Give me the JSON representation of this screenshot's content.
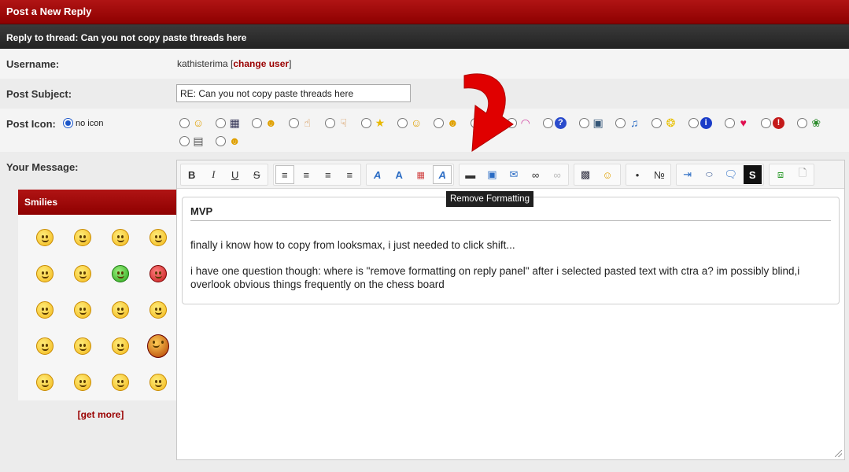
{
  "header": {
    "title": "Post a New Reply"
  },
  "thread": {
    "label": "Reply to thread: Can you not copy paste threads here"
  },
  "username": {
    "label": "Username:",
    "value": "kathisterima",
    "change_label": "change user",
    "open_bracket": "[",
    "close_bracket": "]"
  },
  "subject": {
    "label": "Post Subject:",
    "value": "RE: Can you not copy paste threads here"
  },
  "post_icon": {
    "label": "Post Icon:",
    "no_icon_label": "no icon",
    "icons": [
      "smile-icon",
      "film-icon",
      "tongue-icon",
      "thumbs-up-icon",
      "thumbs-down-icon",
      "star-icon",
      "wink-icon",
      "laugh-icon",
      "sad-icon",
      "rainbow-icon",
      "question-icon",
      "picture-icon",
      "music-icon",
      "lightbulb-icon",
      "info-icon",
      "heart-icon",
      "exclamation-icon",
      "bug-icon",
      "clapper-icon",
      "grin-icon"
    ]
  },
  "message": {
    "label": "Your Message:"
  },
  "smilies": {
    "title": "Smilies",
    "get_more": "[get more]"
  },
  "editor": {
    "toolbar": {
      "bold": "B",
      "italic": "I",
      "underline": "U",
      "strike": "S",
      "groups": [
        [
          "bold-icon",
          "italic-icon",
          "underline-icon",
          "strikethrough-icon"
        ],
        [
          "align-left-icon",
          "align-center-icon",
          "align-right-icon",
          "justify-icon"
        ],
        [
          "font-icon",
          "font-size-icon",
          "color-icon",
          "remove-formatting-icon"
        ],
        [
          "horizontal-rule-icon",
          "image-icon",
          "email-icon",
          "link-icon",
          "unlink-icon"
        ],
        [
          "video-icon",
          "emoticon-icon"
        ],
        [
          "bullet-list-icon",
          "numbered-list-icon"
        ],
        [
          "indent-icon",
          "php-icon",
          "quote-icon",
          "spoiler-icon"
        ],
        [
          "source-icon",
          "page-icon"
        ]
      ]
    },
    "tooltip": "Remove Formatting",
    "quote_title": "MVP",
    "paragraph_1": "finally i know how to copy from looksmax, i just needed to click shift...",
    "paragraph_2": "i have one question though: where is \"remove formatting on reply panel\"  after i selected pasted text with ctra a? im possibly blind,i overlook obvious things frequently on the chess board"
  }
}
